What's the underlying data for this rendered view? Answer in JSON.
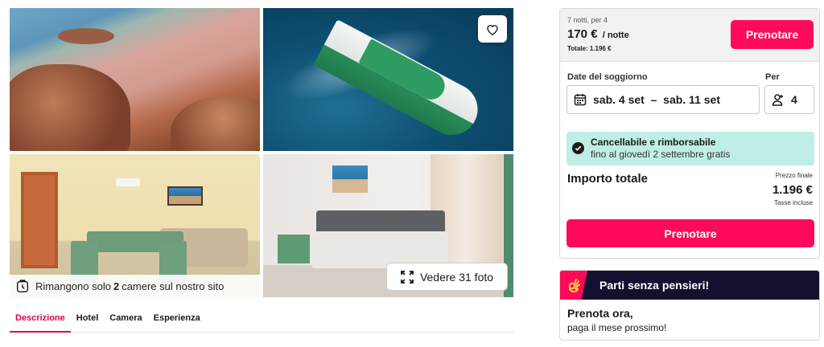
{
  "gallery": {
    "rooms_prefix": "Rimangono solo",
    "rooms_count": "2",
    "rooms_suffix": "camere sul nostro sito",
    "see_photos": "Vedere 31 foto"
  },
  "tabs": [
    {
      "label": "Descrizione",
      "active": true
    },
    {
      "label": "Hotel",
      "active": false
    },
    {
      "label": "Camera",
      "active": false
    },
    {
      "label": "Esperienza",
      "active": false
    }
  ],
  "booking": {
    "nights_info": "7 notti, per 4",
    "price": "170 €",
    "price_unit": "/ notte",
    "total_line": "Totale: 1.196 €",
    "book_top": "Prenotare",
    "dates_label": "Date del soggiorno",
    "dates_value": "sab. 4 set  –  sab. 11 set",
    "guests_label": "Per",
    "guests_value": "4",
    "cancel_title": "Cancellabile e rimborsabile",
    "cancel_sub": "fino al giovedì 2 settembre gratis",
    "total_label": "Importo totale",
    "final_price_label": "Prezzo finale",
    "final_price": "1.196 €",
    "tax_label": "Tasse incluse",
    "book_main": "Prenotare"
  },
  "promo": {
    "title": "Parti senza pensieri!",
    "line1": "Prenota ora,",
    "line2": "paga il mese prossimo!"
  },
  "colors": {
    "accent": "#ff0a5a",
    "tab_active": "#e0004d",
    "cancel_bg": "#bfeee6",
    "promo_bg": "#14102e"
  },
  "icons": [
    "heart-icon",
    "clock-icon",
    "expand-icon",
    "calendar-icon",
    "person-icon",
    "check-circle-icon",
    "ok-hand-icon"
  ]
}
